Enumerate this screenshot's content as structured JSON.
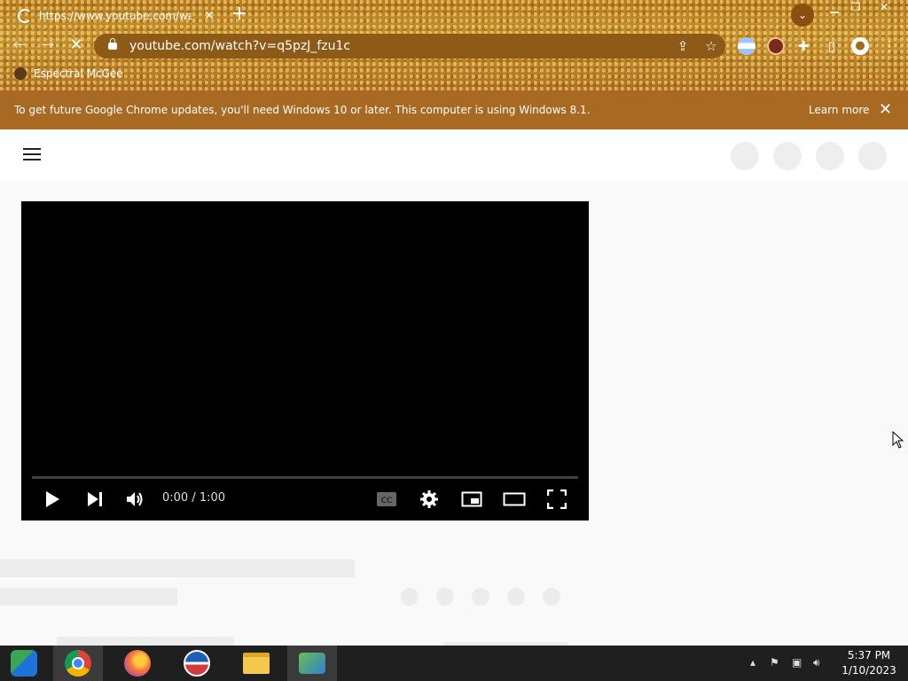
{
  "browser": {
    "tab_title": "https://www.youtube.com/watch?",
    "url": "youtube.com/watch?v=q5pzJ_fzu1c",
    "bookmark_label": "Espectral McGee"
  },
  "infobar": {
    "message": "To get future Google Chrome updates, you'll need Windows 10 or later. This computer is using Windows 8.1.",
    "learn_more": "Learn more"
  },
  "player": {
    "time": "0:00 / 1:00"
  },
  "taskbar": {
    "time": "5:37 PM",
    "date": "1/10/2023"
  }
}
